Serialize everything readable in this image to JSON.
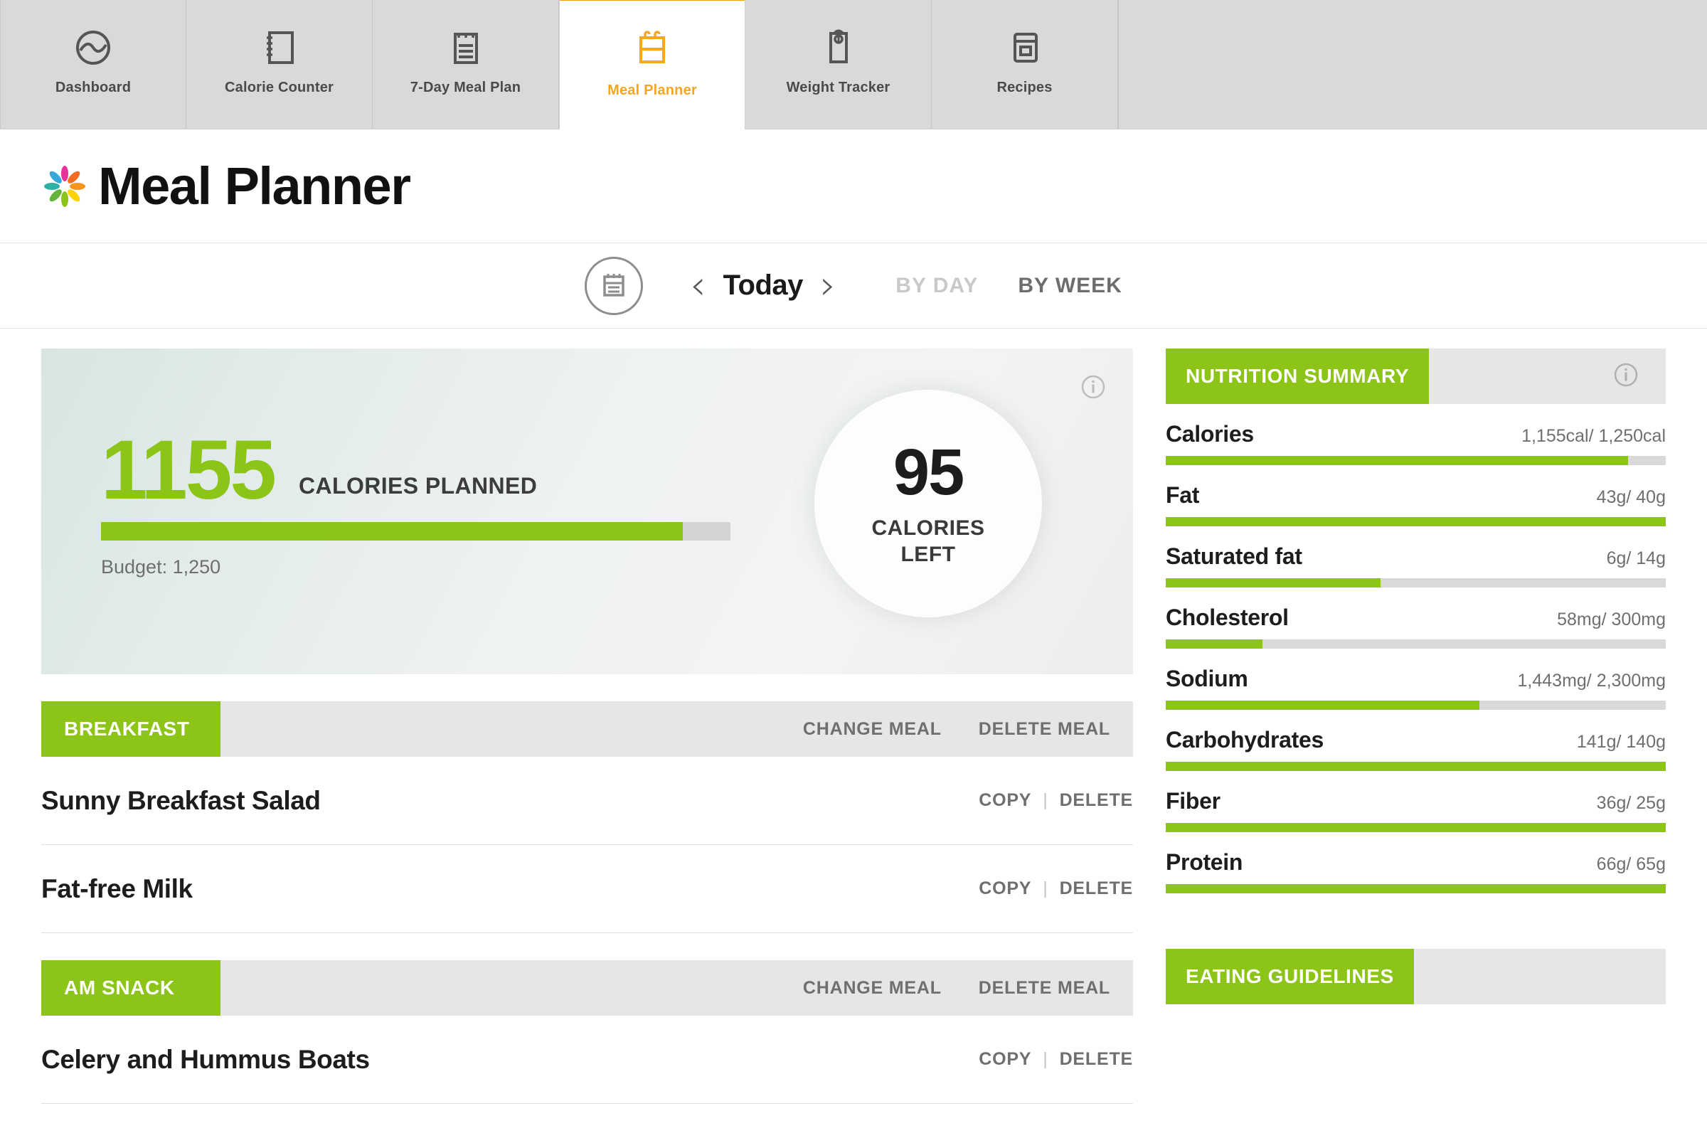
{
  "tabs": [
    {
      "label": "Dashboard",
      "icon": "dashboard-circle-icon",
      "active": false
    },
    {
      "label": "Calorie Counter",
      "icon": "notebook-icon",
      "active": false
    },
    {
      "label": "7-Day Meal Plan",
      "icon": "meal-plan-list-icon",
      "active": false
    },
    {
      "label": "Meal Planner",
      "icon": "calendar-icon",
      "active": true
    },
    {
      "label": "Weight Tracker",
      "icon": "scale-icon",
      "active": false
    },
    {
      "label": "Recipes",
      "icon": "recipe-card-icon",
      "active": false
    }
  ],
  "header": {
    "title": "Meal Planner",
    "logo_icon": "pinwheel-logo-icon"
  },
  "datebar": {
    "calendar_icon": "calendar-notepad-icon",
    "prev_icon": "chevron-left-icon",
    "current_label": "Today",
    "next_icon": "chevron-right-icon",
    "by_day_label": "BY DAY",
    "by_week_label": "BY WEEK",
    "by_day_active": false,
    "by_week_active": true
  },
  "hero": {
    "info_icon": "info-icon",
    "calories_planned": "1155",
    "calories_planned_label": "CALORIES PLANNED",
    "budget_label": "Budget: 1,250",
    "progress_percent": 92.4,
    "calories_left_value": "95",
    "calories_left_label_line1": "CALORIES",
    "calories_left_label_line2": "LEFT"
  },
  "meal_actions": {
    "change_meal": "CHANGE MEAL",
    "delete_meal": "DELETE MEAL",
    "copy": "COPY",
    "separator": "|",
    "delete": "DELETE"
  },
  "meals": [
    {
      "name": "BREAKFAST",
      "foods": [
        {
          "name": "Sunny Breakfast Salad"
        },
        {
          "name": "Fat-free Milk"
        }
      ]
    },
    {
      "name": "AM SNACK",
      "foods": [
        {
          "name": "Celery and Hummus Boats"
        }
      ]
    }
  ],
  "nutrition": {
    "title": "NUTRITION SUMMARY",
    "info_icon": "info-icon",
    "rows": [
      {
        "name": "Calories",
        "value": "1,155cal/ 1,250cal",
        "percent": 92.4
      },
      {
        "name": "Fat",
        "value": "43g/ 40g",
        "percent": 100
      },
      {
        "name": "Saturated fat",
        "value": "6g/ 14g",
        "percent": 43
      },
      {
        "name": "Cholesterol",
        "value": "58mg/ 300mg",
        "percent": 19.3
      },
      {
        "name": "Sodium",
        "value": "1,443mg/ 2,300mg",
        "percent": 62.7
      },
      {
        "name": "Carbohydrates",
        "value": "141g/ 140g",
        "percent": 100
      },
      {
        "name": "Fiber",
        "value": "36g/ 25g",
        "percent": 100
      },
      {
        "name": "Protein",
        "value": "66g/ 65g",
        "percent": 100
      }
    ]
  },
  "eating_guidelines": {
    "title": "EATING GUIDELINES"
  },
  "colors": {
    "green": "#8cc417",
    "orange": "#f5a623",
    "tab_bg": "#d9d9d9",
    "header_gray": "#e6e6e6",
    "track_gray": "#d9d9d9",
    "text_dark": "#1d1d1d",
    "text_muted": "#6f6f6f"
  }
}
